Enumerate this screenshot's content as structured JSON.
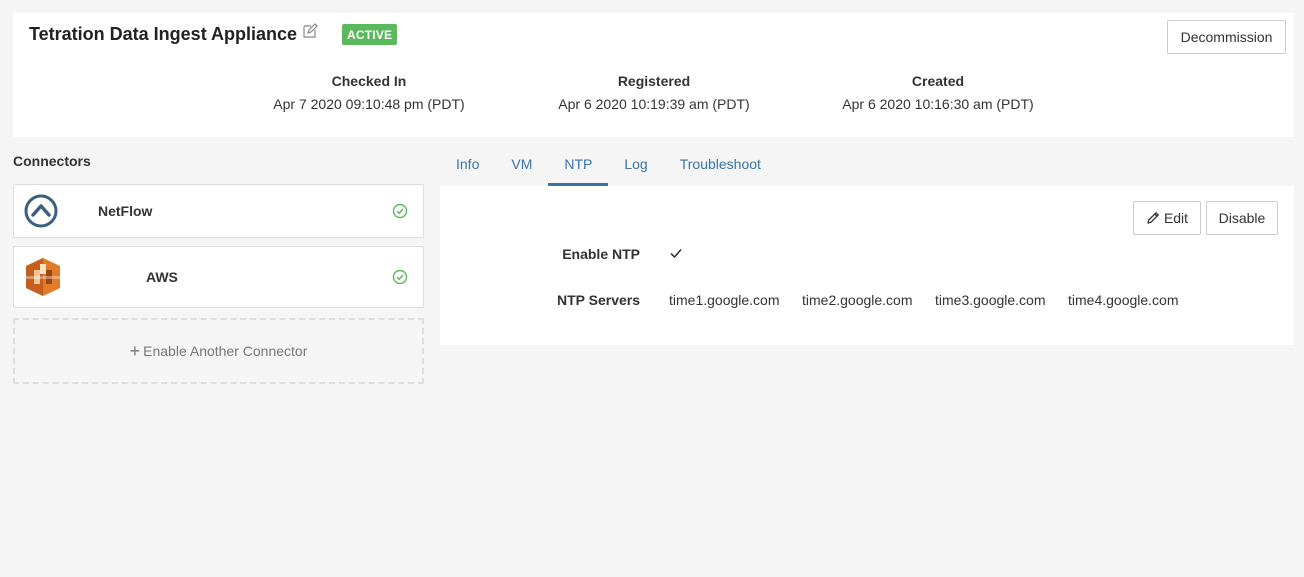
{
  "header": {
    "title": "Tetration Data Ingest Appliance",
    "status_badge": "ACTIVE",
    "decommission_label": "Decommission",
    "checked_in_label": "Checked In",
    "checked_in_value": "Apr 7 2020 09:10:48 pm (PDT)",
    "registered_label": "Registered",
    "registered_value": "Apr 6 2020 10:19:39 am (PDT)",
    "created_label": "Created",
    "created_value": "Apr 6 2020 10:16:30 am (PDT)"
  },
  "connectors": {
    "title": "Connectors",
    "items": [
      {
        "label": "NetFlow",
        "icon": "netflow-icon",
        "status": "enabled"
      },
      {
        "label": "AWS",
        "icon": "aws-icon",
        "status": "enabled"
      }
    ],
    "enable_another_label": "Enable Another Connector"
  },
  "tabs": [
    {
      "label": "Info"
    },
    {
      "label": "VM"
    },
    {
      "label": "NTP",
      "active": true
    },
    {
      "label": "Log"
    },
    {
      "label": "Troubleshoot"
    }
  ],
  "ntp": {
    "edit_label": "Edit",
    "disable_label": "Disable",
    "enable_ntp_label": "Enable NTP",
    "enable_ntp_value": true,
    "servers_label": "NTP Servers",
    "servers": [
      "time1.google.com",
      "time2.google.com",
      "time3.google.com",
      "time4.google.com"
    ]
  },
  "colors": {
    "accent": "#3a73a6",
    "success": "#5cb85c",
    "aws_orange": "#e07b2a"
  }
}
